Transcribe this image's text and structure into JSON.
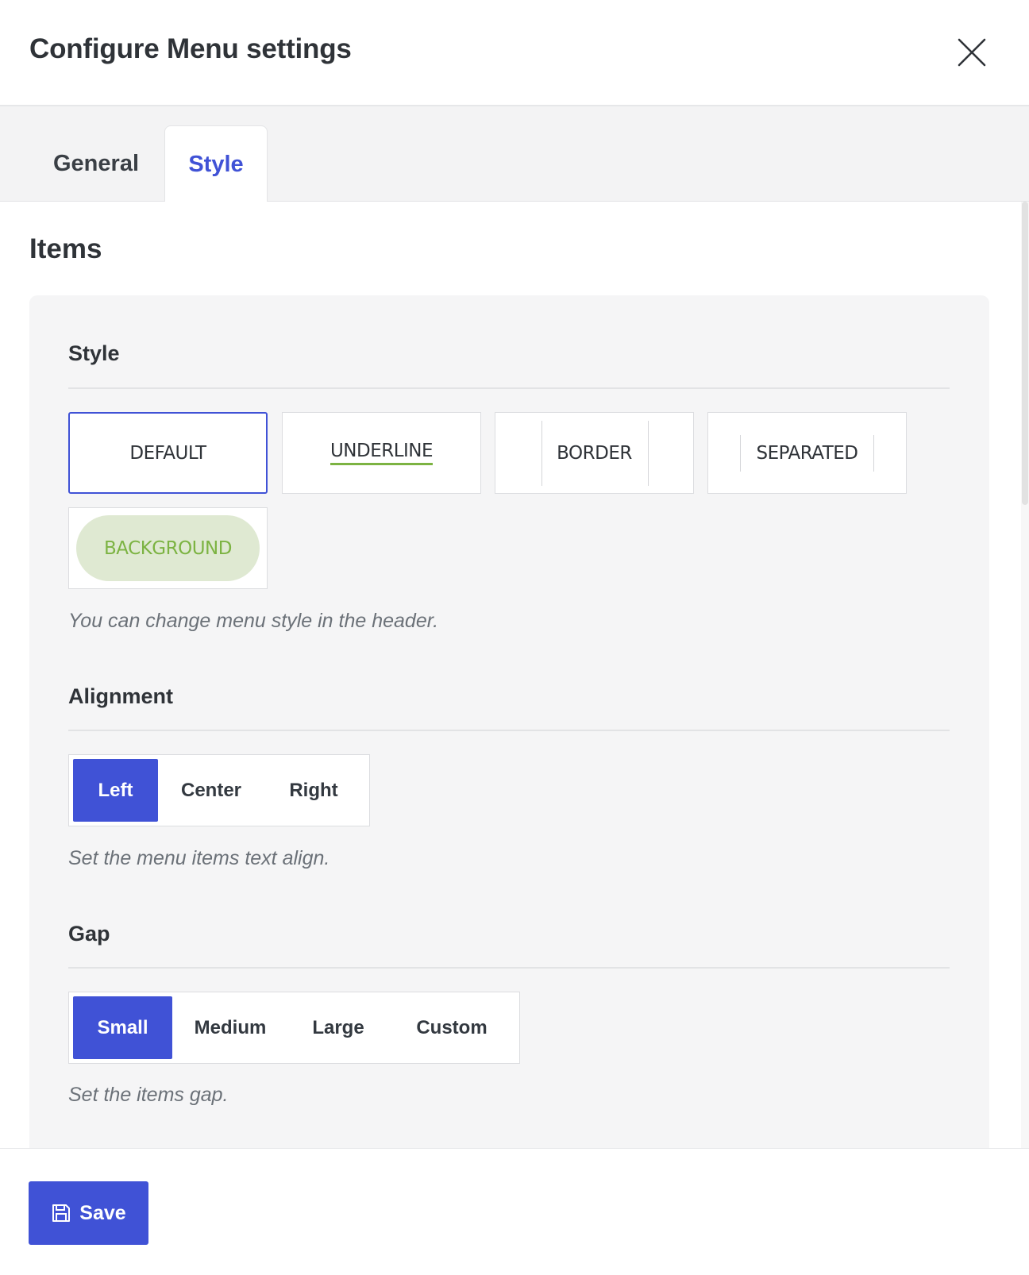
{
  "dialog": {
    "title": "Configure Menu settings",
    "close_icon": "close-icon"
  },
  "tabs": [
    {
      "label": "General",
      "active": false
    },
    {
      "label": "Style",
      "active": true
    }
  ],
  "section": {
    "title": "Items"
  },
  "style_group": {
    "title": "Style",
    "options": [
      {
        "label": "DEFAULT",
        "selected": true
      },
      {
        "label": "UNDERLINE",
        "selected": false
      },
      {
        "label": "BORDER",
        "selected": false
      },
      {
        "label": "SEPARATED",
        "selected": false
      },
      {
        "label": "BACKGROUND",
        "selected": false
      }
    ],
    "help": "You can change menu style in the header."
  },
  "alignment_group": {
    "title": "Alignment",
    "options": [
      "Left",
      "Center",
      "Right"
    ],
    "selected": "Left",
    "help": "Set the menu items text align."
  },
  "gap_group": {
    "title": "Gap",
    "options": [
      "Small",
      "Medium",
      "Large",
      "Custom"
    ],
    "selected": "Small",
    "help": "Set the items gap."
  },
  "footer": {
    "save_label": "Save",
    "save_icon": "floppy-disk-icon"
  },
  "colors": {
    "accent": "#4052d6",
    "style_accent_green": "#7cb342",
    "pill_bg": "#dfe9d2"
  }
}
